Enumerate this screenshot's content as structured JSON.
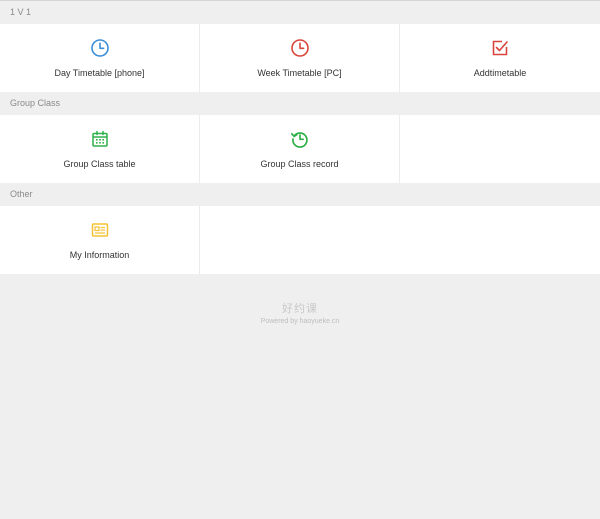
{
  "sections": [
    {
      "title": "1 V 1",
      "items": [
        {
          "label": "Day Timetable [phone]",
          "icon": "clock-icon",
          "color": "#3a8fd9"
        },
        {
          "label": "Week Timetable [PC]",
          "icon": "clock-icon",
          "color": "#d9453a"
        },
        {
          "label": "Addtimetable",
          "icon": "checkbox-edit-icon",
          "color": "#d9453a"
        }
      ]
    },
    {
      "title": "Group Class",
      "items": [
        {
          "label": "Group Class table",
          "icon": "calendar-icon",
          "color": "#2fb14a"
        },
        {
          "label": "Group Class record",
          "icon": "history-icon",
          "color": "#2fb14a"
        }
      ]
    },
    {
      "title": "Other",
      "items": [
        {
          "label": "My Information",
          "icon": "id-card-icon",
          "color": "#f2c233"
        }
      ]
    }
  ],
  "footer": {
    "brand": "好约课",
    "powered": "Powered by haoyueke.cn"
  }
}
